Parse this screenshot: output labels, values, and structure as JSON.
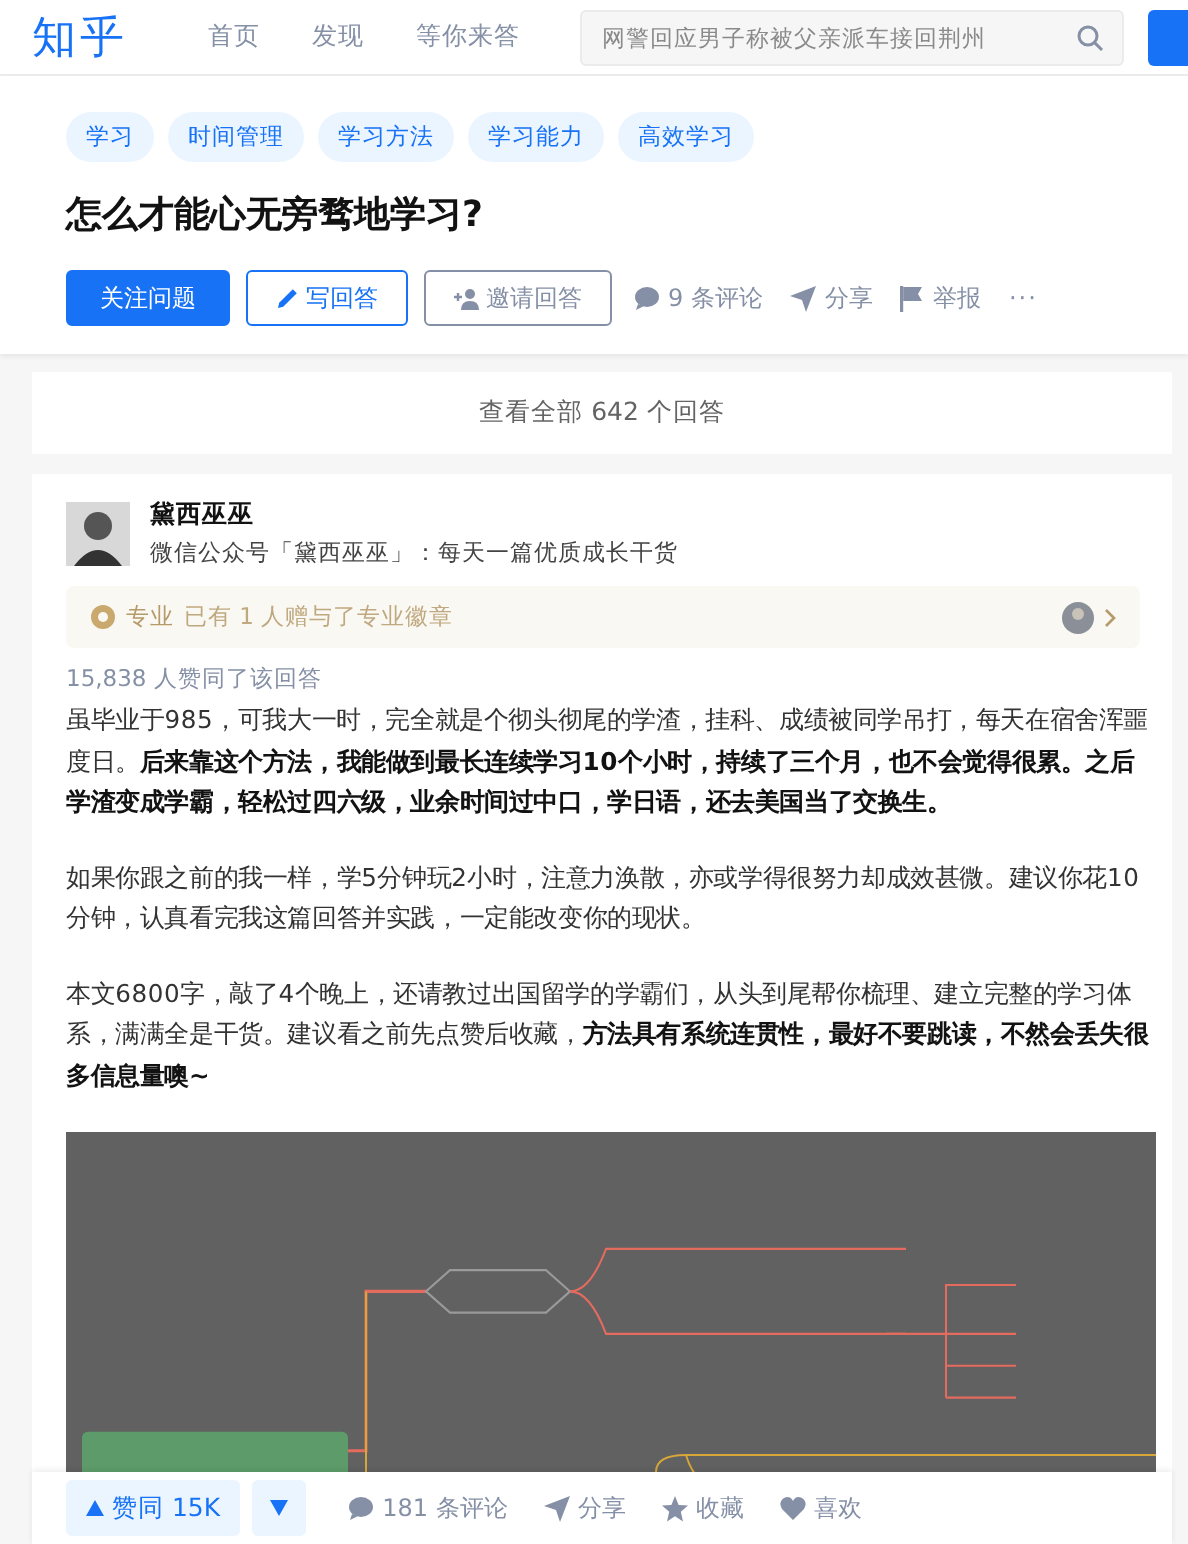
{
  "header": {
    "logo": "知乎",
    "nav": [
      "首页",
      "发现",
      "等你来答"
    ],
    "search": {
      "placeholder": "网警回应男子称被父亲派车接回荆州"
    }
  },
  "question": {
    "topics": [
      "学习",
      "时间管理",
      "学习方法",
      "学习能力",
      "高效学习"
    ],
    "title": "怎么才能心无旁骛地学习?",
    "actions": {
      "follow": "关注问题",
      "write": "写回答",
      "invite": "邀请回答",
      "comments": "9 条评论",
      "share": "分享",
      "report": "举报",
      "more": "···"
    }
  },
  "view_all": "查看全部 642 个回答",
  "answer": {
    "author": {
      "name": "黛西巫巫",
      "bio": "微信公众号「黛西巫巫」：每天一篇优质成长干货"
    },
    "badge": {
      "label": "专业",
      "text": "已有 1 人赠与了专业徽章"
    },
    "votes_text": "15,838 人赞同了该回答",
    "paragraphs": [
      "虽毕业于985，可我大一时，完全就是个彻头彻尾的学渣，挂科、成绩被同学吊打，每天在宿舍浑噩度日。**后来靠这个方法，我能做到最长连续学习10个小时，持续了三个月，也不会觉得很累。之后学渣变成学霸，轻松过四六级，业余时间过中口，学日语，还去美国当了交换生。**",
      "如果你跟之前的我一样，学5分钟玩2小时，注意力涣散，亦或学得很努力却成效甚微。建议你花10分钟，认真看完我这篇回答并实践，一定能改变你的现状。",
      "本文6800字，敲了4个晚上，还请教过出国留学的学霸们，从头到尾帮你梳理、建立完整的学习体系，满满全是干货。建议看之前先点赞后收藏，**方法具有系统连贯性，最好不要跳读，不然会丢失很多信息量噢~**"
    ]
  },
  "action_bar": {
    "upvote": "赞同 15K",
    "comments": "181 条评论",
    "share": "分享",
    "collect": "收藏",
    "like": "喜欢"
  }
}
